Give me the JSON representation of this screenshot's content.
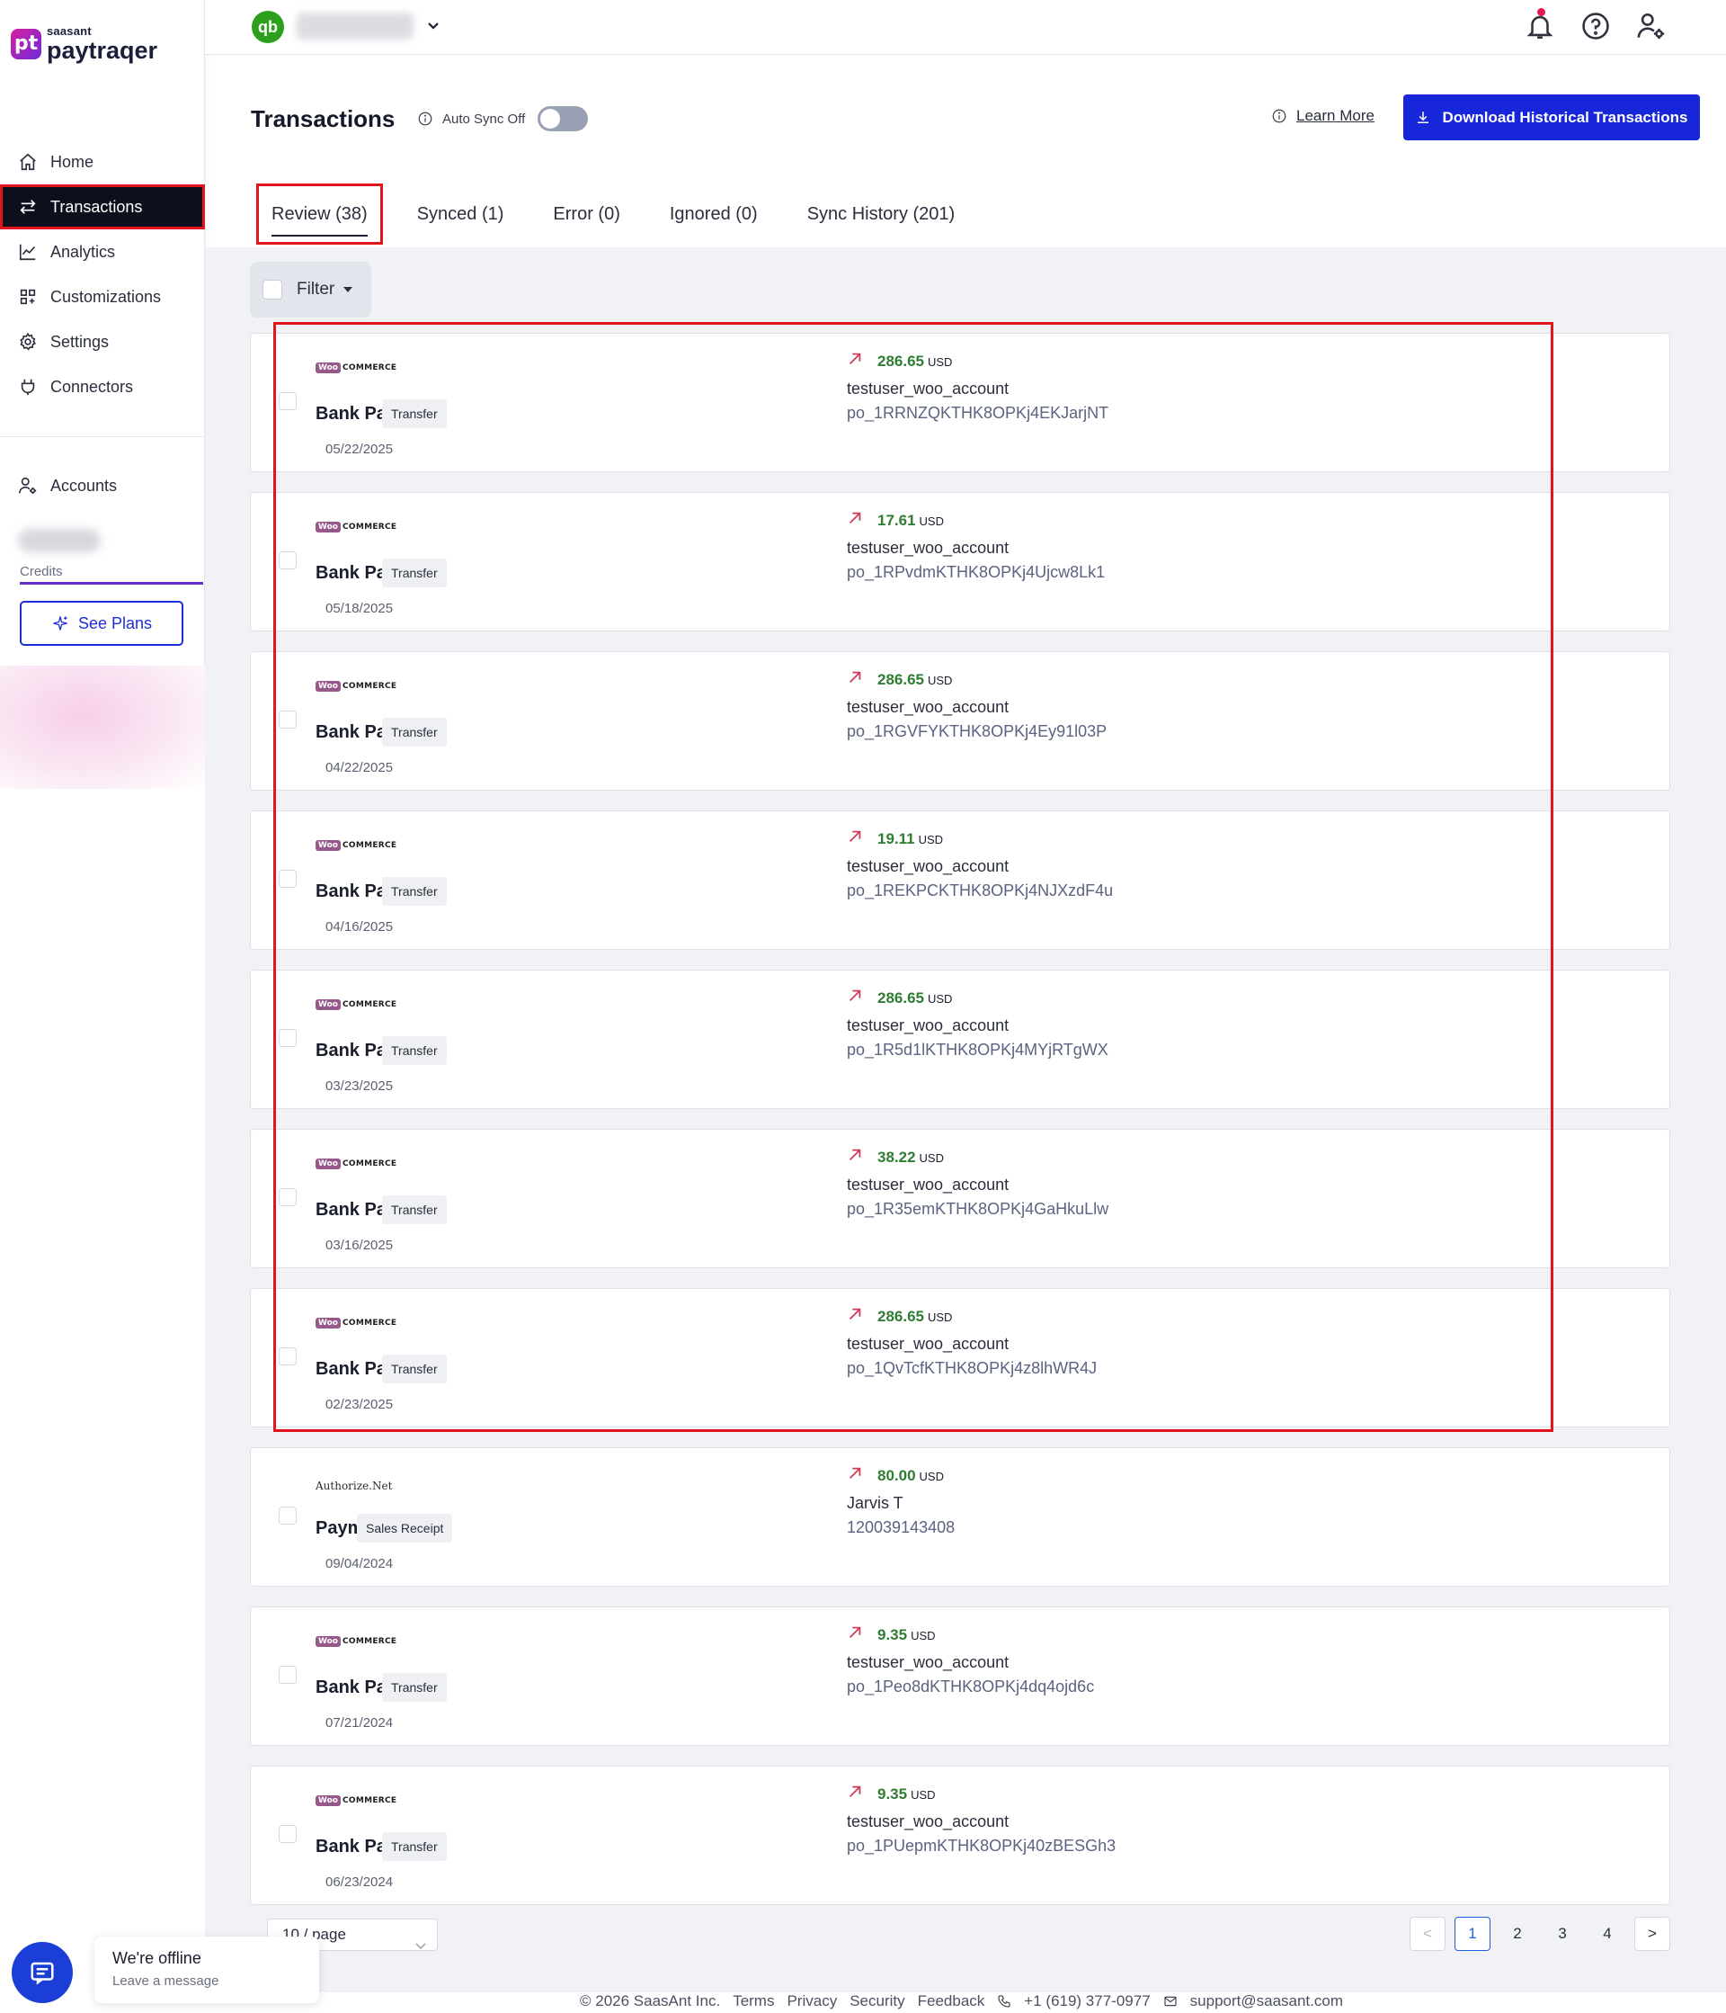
{
  "sidebar": {
    "brand_small": "saasant",
    "brand_name": "paytraqer",
    "brand_mark": "pt",
    "nav_items": [
      {
        "label": "Home",
        "icon": "home-icon"
      },
      {
        "label": "Transactions",
        "icon": "swap-arrows-icon",
        "active": true
      },
      {
        "label": "Analytics",
        "icon": "line-chart-icon"
      },
      {
        "label": "Customizations",
        "icon": "grid-icon"
      },
      {
        "label": "Settings",
        "icon": "gear-icon"
      },
      {
        "label": "Connectors",
        "icon": "plug-icon"
      }
    ],
    "accounts_label": "Accounts",
    "credits_label": "Credits",
    "see_plans_label": "See Plans"
  },
  "topbar": {
    "qb_logo": "qb"
  },
  "header": {
    "title": "Transactions",
    "auto_sync_label": "Auto Sync Off",
    "auto_sync_on": false,
    "learn_more": "Learn More",
    "download_label": "Download Historical Transactions"
  },
  "tabs": [
    {
      "label": "Review (38)",
      "active": true
    },
    {
      "label": "Synced (1)"
    },
    {
      "label": "Error (0)"
    },
    {
      "label": "Ignored (0)"
    },
    {
      "label": "Sync History (201)"
    }
  ],
  "filter": {
    "label": "Filter"
  },
  "transactions": [
    {
      "source": "woo",
      "type": "Bank Payout",
      "tag": "Transfer",
      "date": "05/22/2025",
      "amount": "286.65",
      "currency": "USD",
      "account": "testuser_woo_account",
      "ref": "po_1RRNZQKTHK8OPKj4EKJarjNT"
    },
    {
      "source": "woo",
      "type": "Bank Payout",
      "tag": "Transfer",
      "date": "05/18/2025",
      "amount": "17.61",
      "currency": "USD",
      "account": "testuser_woo_account",
      "ref": "po_1RPvdmKTHK8OPKj4Ujcw8Lk1"
    },
    {
      "source": "woo",
      "type": "Bank Payout",
      "tag": "Transfer",
      "date": "04/22/2025",
      "amount": "286.65",
      "currency": "USD",
      "account": "testuser_woo_account",
      "ref": "po_1RGVFYKTHK8OPKj4Ey91l03P"
    },
    {
      "source": "woo",
      "type": "Bank Payout",
      "tag": "Transfer",
      "date": "04/16/2025",
      "amount": "19.11",
      "currency": "USD",
      "account": "testuser_woo_account",
      "ref": "po_1REKPCKTHK8OPKj4NJXzdF4u"
    },
    {
      "source": "woo",
      "type": "Bank Payout",
      "tag": "Transfer",
      "date": "03/23/2025",
      "amount": "286.65",
      "currency": "USD",
      "account": "testuser_woo_account",
      "ref": "po_1R5d1lKTHK8OPKj4MYjRTgWX"
    },
    {
      "source": "woo",
      "type": "Bank Payout",
      "tag": "Transfer",
      "date": "03/16/2025",
      "amount": "38.22",
      "currency": "USD",
      "account": "testuser_woo_account",
      "ref": "po_1R35emKTHK8OPKj4GaHkuLlw"
    },
    {
      "source": "woo",
      "type": "Bank Payout",
      "tag": "Transfer",
      "date": "02/23/2025",
      "amount": "286.65",
      "currency": "USD",
      "account": "testuser_woo_account",
      "ref": "po_1QvTcfKTHK8OPKj4z8lhWR4J"
    },
    {
      "source": "authorize",
      "type": "Payment",
      "tag": "Sales Receipt",
      "date": "09/04/2024",
      "amount": "80.00",
      "currency": "USD",
      "account": "Jarvis T",
      "ref": "120039143408"
    },
    {
      "source": "woo",
      "type": "Bank Payout",
      "tag": "Transfer",
      "date": "07/21/2024",
      "amount": "9.35",
      "currency": "USD",
      "account": "testuser_woo_account",
      "ref": "po_1Peo8dKTHK8OPKj4dq4ojd6c"
    },
    {
      "source": "woo",
      "type": "Bank Payout",
      "tag": "Transfer",
      "date": "06/23/2024",
      "amount": "9.35",
      "currency": "USD",
      "account": "testuser_woo_account",
      "ref": "po_1PUepmKTHK8OPKj40zBESGh3"
    }
  ],
  "source_logos": {
    "woo_badge": "Woo",
    "woo_rest": "COMMERCE",
    "authorize": "Authorize.Net"
  },
  "pagination": {
    "page_size": "10 / page",
    "prev": "<",
    "next": ">",
    "pages": [
      "1",
      "2",
      "3",
      "4"
    ],
    "current": "1"
  },
  "footer": {
    "copyright": "© 2026 SaasAnt Inc.",
    "links": [
      "Terms",
      "Privacy",
      "Security",
      "Feedback"
    ],
    "phone": "+1 (619) 377-0977",
    "email": "support@saasant.com"
  },
  "chat": {
    "title": "We're offline",
    "subtitle": "Leave a message"
  },
  "colors": {
    "primary": "#1726d8",
    "highlight": "#e3151c",
    "amount_green": "#2f7d32",
    "arrow_red": "#d13b57",
    "sidebar_active_bg": "#0d0f1c"
  }
}
